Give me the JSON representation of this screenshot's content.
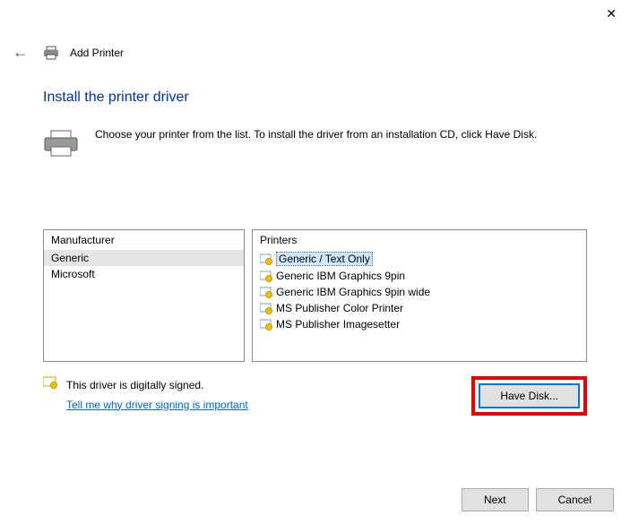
{
  "header": {
    "title": "Add Printer"
  },
  "page": {
    "heading": "Install the printer driver",
    "instruction": "Choose your printer from the list. To install the driver from an installation CD, click Have Disk."
  },
  "lists": {
    "manufacturer_header": "Manufacturer",
    "printers_header": "Printers",
    "manufacturers": [
      {
        "label": "Generic",
        "selected": true
      },
      {
        "label": "Microsoft",
        "selected": false
      }
    ],
    "printers": [
      {
        "label": "Generic / Text Only",
        "selected": true
      },
      {
        "label": "Generic IBM Graphics 9pin",
        "selected": false
      },
      {
        "label": "Generic IBM Graphics 9pin wide",
        "selected": false
      },
      {
        "label": "MS Publisher Color Printer",
        "selected": false
      },
      {
        "label": "MS Publisher Imagesetter",
        "selected": false
      }
    ]
  },
  "signing": {
    "status": "This driver is digitally signed.",
    "link": "Tell me why driver signing is important"
  },
  "buttons": {
    "have_disk": "Have Disk...",
    "next": "Next",
    "cancel": "Cancel"
  }
}
